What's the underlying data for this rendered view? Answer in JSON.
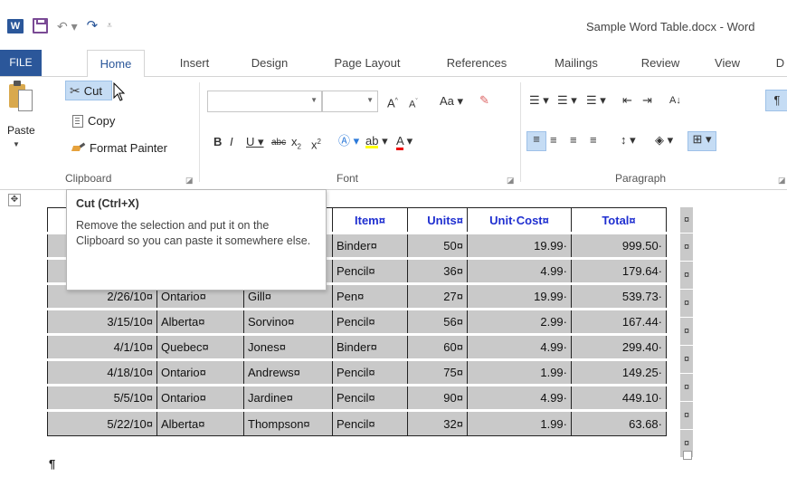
{
  "app": {
    "logo_text": "W",
    "document_title": "Sample Word Table.docx - Word"
  },
  "tabs": [
    {
      "label": "FILE"
    },
    {
      "label": "Home"
    },
    {
      "label": "Insert"
    },
    {
      "label": "Design"
    },
    {
      "label": "Page Layout"
    },
    {
      "label": "References"
    },
    {
      "label": "Mailings"
    },
    {
      "label": "Review"
    },
    {
      "label": "View"
    },
    {
      "label": "D"
    }
  ],
  "clipboard": {
    "paste": "Paste",
    "cut": "Cut",
    "copy": "Copy",
    "format_painter": "Format Painter",
    "group": "Clipboard"
  },
  "font": {
    "group": "Font",
    "font_name": "",
    "font_size": ""
  },
  "paragraph": {
    "group": "Paragraph"
  },
  "tooltip": {
    "title": "Cut (Ctrl+X)",
    "body": "Remove the selection and put it on the Clipboard so you can paste it somewhere else."
  },
  "table": {
    "headers": [
      "",
      "",
      "",
      "Item¤",
      "Units¤",
      "Unit·Cost¤",
      "Total¤"
    ],
    "rows": [
      [
        "",
        "",
        "",
        "Binder¤",
        "50¤",
        "19.99·",
        "999.50·"
      ],
      [
        "",
        "",
        "",
        "Pencil¤",
        "36¤",
        "4.99·",
        "179.64·"
      ],
      [
        "2/26/10¤",
        "Ontario¤",
        "Gill¤",
        "Pen¤",
        "27¤",
        "19.99·",
        "539.73·"
      ],
      [
        "3/15/10¤",
        "Alberta¤",
        "Sorvino¤",
        "Pencil¤",
        "56¤",
        "2.99·",
        "167.44·"
      ],
      [
        "4/1/10¤",
        "Quebec¤",
        "Jones¤",
        "Binder¤",
        "60¤",
        "4.99·",
        "299.40·"
      ],
      [
        "4/18/10¤",
        "Ontario¤",
        "Andrews¤",
        "Pencil¤",
        "75¤",
        "1.99·",
        "149.25·"
      ],
      [
        "5/5/10¤",
        "Ontario¤",
        "Jardine¤",
        "Pencil¤",
        "90¤",
        "4.99·",
        "449.10·"
      ],
      [
        "5/22/10¤",
        "Alberta¤",
        "Thompson¤",
        "Pencil¤",
        "32¤",
        "1.99·",
        "63.68·"
      ]
    ],
    "end_mark": "¤"
  },
  "paragraph_mark": "¶"
}
